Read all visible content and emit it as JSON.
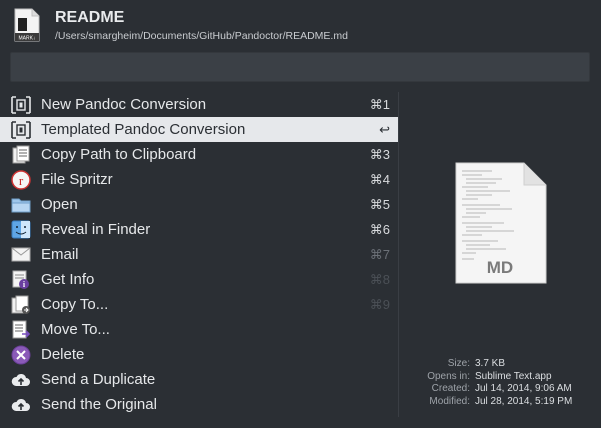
{
  "header": {
    "file_icon": "markdown-file-icon",
    "file_icon_text": "MARK↓",
    "title": "README",
    "path": "/Users/smargheim/Documents/GitHub/Pandoctor/README.md"
  },
  "search": {
    "value": ""
  },
  "actions": [
    {
      "label": "New Pandoc Conversion",
      "shortcut": "⌘1",
      "icon": "pandoc-icon",
      "selected": false,
      "shortcut_style": "normal"
    },
    {
      "label": "Templated Pandoc Conversion",
      "shortcut": "↩",
      "icon": "pandoc-icon",
      "selected": true,
      "shortcut_style": "normal"
    },
    {
      "label": "Copy Path to Clipboard",
      "shortcut": "⌘3",
      "icon": "clipboard-icon",
      "selected": false,
      "shortcut_style": "normal"
    },
    {
      "label": "File Spritzr",
      "shortcut": "⌘4",
      "icon": "spritz-icon",
      "selected": false,
      "shortcut_style": "normal"
    },
    {
      "label": "Open",
      "shortcut": "⌘5",
      "icon": "folder-icon",
      "selected": false,
      "shortcut_style": "normal"
    },
    {
      "label": "Reveal in Finder",
      "shortcut": "⌘6",
      "icon": "finder-icon",
      "selected": false,
      "shortcut_style": "normal"
    },
    {
      "label": "Email",
      "shortcut": "⌘7",
      "icon": "envelope-icon",
      "selected": false,
      "shortcut_style": "dim"
    },
    {
      "label": "Get Info",
      "shortcut": "⌘8",
      "icon": "info-icon",
      "selected": false,
      "shortcut_style": "dimmer"
    },
    {
      "label": "Copy To...",
      "shortcut": "⌘9",
      "icon": "copy-to-icon",
      "selected": false,
      "shortcut_style": "dimmer"
    },
    {
      "label": "Move To...",
      "shortcut": "",
      "icon": "move-to-icon",
      "selected": false,
      "shortcut_style": "normal"
    },
    {
      "label": "Delete",
      "shortcut": "",
      "icon": "delete-icon",
      "selected": false,
      "shortcut_style": "normal"
    },
    {
      "label": "Send a Duplicate",
      "shortcut": "",
      "icon": "cloud-upload-icon",
      "selected": false,
      "shortcut_style": "normal"
    },
    {
      "label": "Send the Original",
      "shortcut": "",
      "icon": "cloud-upload-icon",
      "selected": false,
      "shortcut_style": "normal"
    }
  ],
  "preview": {
    "icon": "text-document-icon",
    "badge": "MD"
  },
  "details": [
    {
      "key": "Size:",
      "value": "3.7 KB"
    },
    {
      "key": "Opens in:",
      "value": "Sublime Text.app"
    },
    {
      "key": "Created:",
      "value": "Jul 14, 2014, 9:06 AM"
    },
    {
      "key": "Modified:",
      "value": "Jul 28, 2014, 5:19 PM"
    }
  ],
  "colors": {
    "background": "#2b2f34",
    "selection": "#e6e8eb",
    "search_field": "#3b4046"
  }
}
